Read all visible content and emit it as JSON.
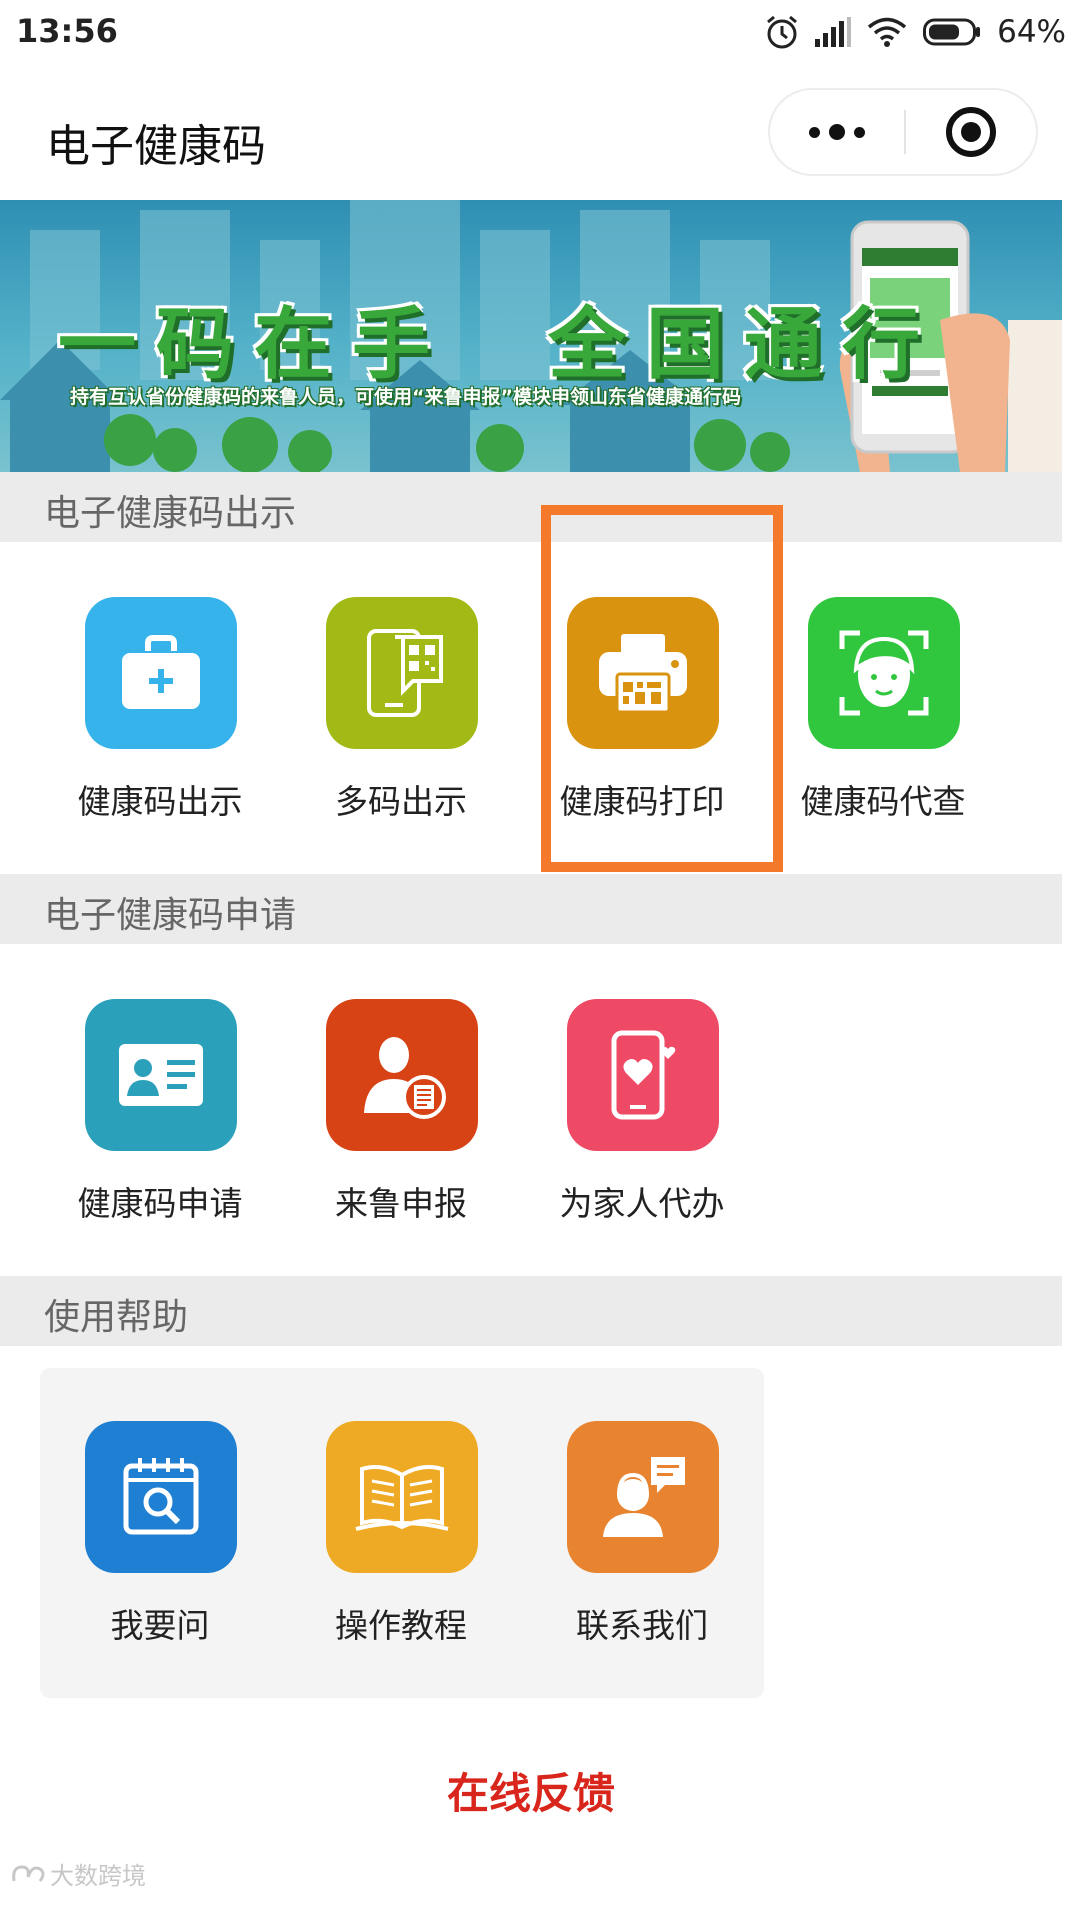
{
  "status_bar": {
    "time": "13:56",
    "battery_percent": "64%",
    "icons": [
      "alarm-icon",
      "signal-icon",
      "wifi-icon",
      "battery-icon"
    ]
  },
  "title_bar": {
    "title": "电子健康码",
    "buttons": [
      "more-icon",
      "close-target-icon"
    ]
  },
  "banner": {
    "slogan": "一码在手　全国通行",
    "subtitle": "持有互认省份健康码的来鲁人员，可使用“来鲁申报”模块申领山东省健康通行码"
  },
  "sections": [
    {
      "title": "电子健康码出示",
      "items": [
        {
          "label": "健康码出示",
          "icon": "medical-kit-icon",
          "color": "#35b3ea"
        },
        {
          "label": "多码出示",
          "icon": "phone-qr-icon",
          "color": "#a2b916"
        },
        {
          "label": "健康码打印",
          "icon": "printer-icon",
          "color": "#d9930e"
        },
        {
          "label": "健康码代查",
          "icon": "face-scan-icon",
          "color": "#30c73e"
        }
      ]
    },
    {
      "title": "电子健康码申请",
      "items": [
        {
          "label": "健康码申请",
          "icon": "id-card-icon",
          "color": "#2aa0bb"
        },
        {
          "label": "来鲁申报",
          "icon": "person-document-icon",
          "color": "#d84315"
        },
        {
          "label": "为家人代办",
          "icon": "phone-heart-icon",
          "color": "#ee4965"
        }
      ]
    },
    {
      "title": "使用帮助",
      "items": [
        {
          "label": "我要问",
          "icon": "calendar-search-icon",
          "color": "#1f7fd2"
        },
        {
          "label": "操作教程",
          "icon": "open-book-icon",
          "color": "#eeaa24"
        },
        {
          "label": "联系我们",
          "icon": "customer-service-icon",
          "color": "#e8832f"
        }
      ]
    }
  ],
  "feedback_link": "在线反馈",
  "watermark": "大数跨境",
  "colors": {
    "highlight_box": "#f5792a",
    "feedback_text": "#d9261c",
    "section_header_bg": "#ebebeb"
  }
}
